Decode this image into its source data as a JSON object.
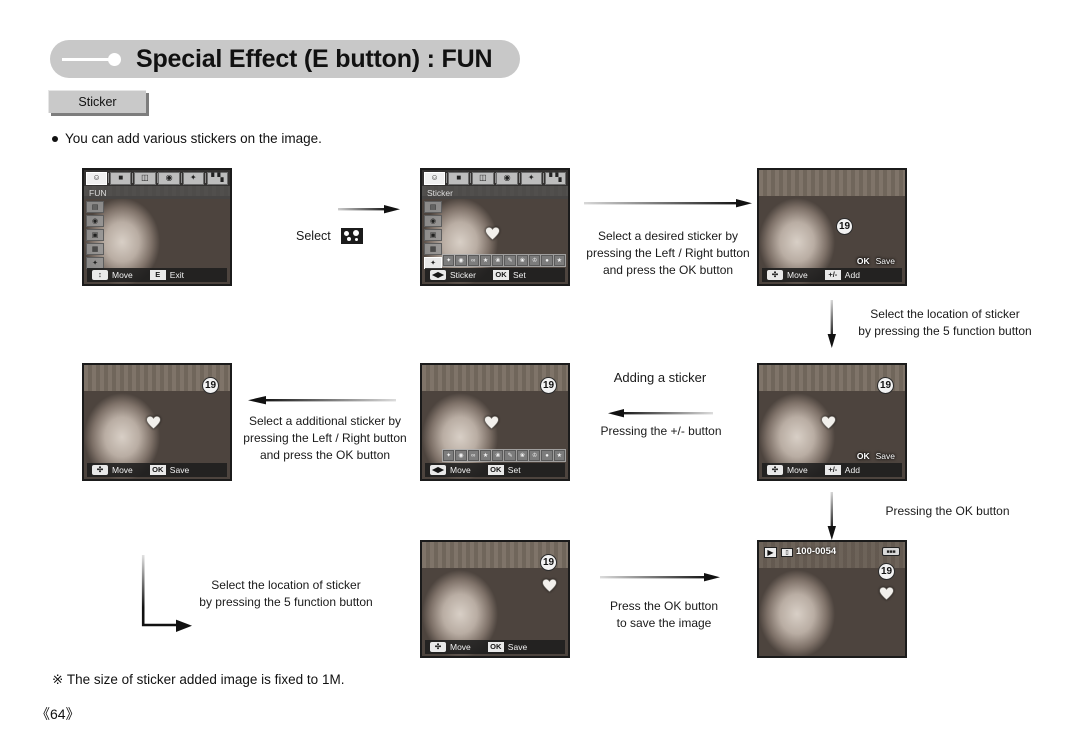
{
  "header": {
    "title": "Special Effect (E button) : FUN",
    "sub_tab": "Sticker"
  },
  "intro": {
    "bullet_text": "You can add various stickers on the image."
  },
  "labels": {
    "select": "Select",
    "adding_a_sticker": "Adding a sticker"
  },
  "steps": {
    "select_desired_sticker": "Select a desired sticker by\npressing the Left / Right button\nand press the OK button",
    "select_location_1": "Select the location of sticker\nby pressing the 5 function button",
    "pressing_plus_minus": "Pressing the +/- button",
    "select_additional_sticker": "Select a additional sticker by\npressing the Left / Right button\nand press the OK button",
    "pressing_ok": "Pressing the OK button",
    "select_location_2": "Select the location of sticker\nby pressing the 5 function button",
    "press_ok_save": "Press the OK button\nto save the image"
  },
  "screens": {
    "s1": {
      "name": "fun-menu",
      "mode_label": "FUN",
      "menu_icons": [
        "smiley-icon",
        "photo-frame-icon",
        "composite-icon",
        "palette-icon",
        "sticker-icon",
        "histogram-icon"
      ],
      "active_menu_index": 0,
      "side_icons": [
        "highlight-icon",
        "color-icon",
        "frame-icon",
        "composite-icon",
        "sticker-icon"
      ],
      "side_selected_index": -1,
      "status": [
        {
          "key": "↕",
          "text": "Move"
        },
        {
          "key": "E",
          "text": "Exit"
        }
      ]
    },
    "s2": {
      "name": "sticker-select",
      "mode_label": "Sticker",
      "menu_icons": [
        "smiley-icon",
        "photo-frame-icon",
        "composite-icon",
        "palette-icon",
        "sticker-icon",
        "histogram-icon"
      ],
      "active_menu_index": 0,
      "side_icons": [
        "highlight-icon",
        "color-icon",
        "frame-icon",
        "composite-icon",
        "sticker-icon"
      ],
      "side_selected_index": 4,
      "sticker_strip": [
        "heart",
        "clock",
        "glasses",
        "lips",
        "ribbon",
        "pen",
        "flower",
        "crown",
        "drop",
        "star"
      ],
      "status": [
        {
          "key": "◀▶",
          "text": "Sticker"
        },
        {
          "key": "OK",
          "text": "Set"
        }
      ]
    },
    "s3": {
      "name": "sticker-placement-1",
      "badge": "19",
      "float_key": "OK",
      "float_text": "Save",
      "status": [
        {
          "key": "✣",
          "text": "Move"
        },
        {
          "key": "+/-",
          "text": "Add"
        }
      ]
    },
    "s4": {
      "name": "sticker-placement-2",
      "badge": "19",
      "float_key": "OK",
      "float_text": "Save",
      "status": [
        {
          "key": "✣",
          "text": "Move"
        },
        {
          "key": "+/-",
          "text": "Add"
        }
      ]
    },
    "s5": {
      "name": "sticker-second-select",
      "mode_label": "",
      "menu_icons": [
        "smiley-icon",
        "photo-frame-icon",
        "composite-icon",
        "palette-icon",
        "sticker-icon",
        "histogram-icon"
      ],
      "badge": "19",
      "sticker_strip": [
        "heart",
        "clock",
        "glasses",
        "lips",
        "ribbon",
        "pen",
        "flower",
        "crown",
        "drop",
        "star"
      ],
      "status": [
        {
          "key": "◀▶",
          "text": "Move"
        },
        {
          "key": "OK",
          "text": "Set"
        }
      ]
    },
    "s6": {
      "name": "sticker-placement-3",
      "badge": "19",
      "status": [
        {
          "key": "✣",
          "text": "Move"
        },
        {
          "key": "OK",
          "text": "Save"
        }
      ]
    },
    "s7": {
      "name": "sticker-saved-playback",
      "badge": "19",
      "play_icon": "play-icon",
      "card_icon": "memory-card-icon",
      "file_number": "100-0054",
      "battery_icon": "battery-icon"
    }
  },
  "footer": {
    "note": "※ The size of sticker added image is fixed to 1M.",
    "page": "《64》"
  }
}
